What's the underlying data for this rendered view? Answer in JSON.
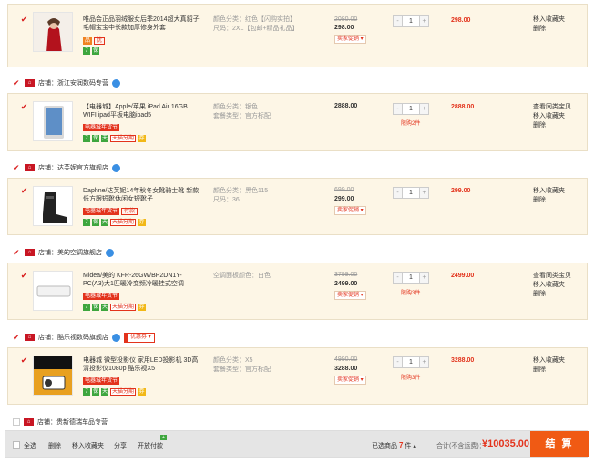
{
  "items": [
    {
      "title": "唯品会正品羽绒服女后季2014超大真貂子毛帽宝宝中长款加厚修身外套",
      "tags": [],
      "icons": [
        "7",
        "保"
      ],
      "attr1": "颜色分类：红色【闪购实拍】",
      "attr2": "尺码：2XL【包邮+精品礼品】",
      "old_price": "2080.00",
      "price": "298.00",
      "promo": "卖家促销 ▾",
      "qty": "1",
      "limit": "",
      "total": "298.00",
      "ops": [
        "移入收藏夹",
        "删除"
      ]
    },
    {
      "title": "【电器城】Apple/苹果 iPad Air 16GB WIFI ipad平板电脑ipad5",
      "tags": [
        "电器城年货节"
      ],
      "icons": [
        "7",
        "保",
        "天",
        "天猫分期",
        "券"
      ],
      "attr1": "颜色分类：银色",
      "attr2": "套餐类型：官方标配",
      "old_price": "",
      "price": "2888.00",
      "promo": "",
      "qty": "1",
      "limit": "限购2件",
      "total": "2888.00",
      "ops": [
        "查看同类宝贝",
        "移入收藏夹",
        "删除"
      ]
    },
    {
      "title": "Daphne/达芙妮14年秋冬女靴骑士靴 新款低方跟短靴休闲女短靴子",
      "tags": [
        "电器城年货节",
        "付款"
      ],
      "icons": [
        "7",
        "保",
        "天",
        "天猫分期",
        "券"
      ],
      "attr1": "颜色分类：黑色115",
      "attr2": "尺码：36",
      "old_price": "699.00",
      "price": "299.00",
      "promo": "卖家促销 ▾",
      "qty": "1",
      "limit": "",
      "total": "299.00",
      "ops": [
        "移入收藏夹",
        "删除"
      ]
    },
    {
      "title": "Midea/美的 KFR-26GW/BP2DN1Y-PC(A3)大1匹暖冷变频冷暖挂式空调",
      "tags": [
        "电器城年货节"
      ],
      "icons": [
        "7",
        "保",
        "天",
        "天猫分期",
        "券"
      ],
      "attr1": "空调面板颜色：白色",
      "attr2": "",
      "old_price": "3799.00",
      "price": "2499.00",
      "promo": "卖家促销 ▾",
      "qty": "1",
      "limit": "限购3件",
      "total": "2499.00",
      "ops": [
        "查看同类宝贝",
        "移入收藏夹",
        "删除"
      ]
    },
    {
      "title": "电器城 微型投影仪 家用LED投影机 3D高清投影仪1080p 酷乐视X5",
      "tags": [
        "电器城年货节"
      ],
      "icons": [
        "7",
        "保",
        "天",
        "天猫分期",
        "券"
      ],
      "attr1": "颜色分类：X5",
      "attr2": "套餐类型：官方标配",
      "old_price": "4990.00",
      "price": "3288.00",
      "promo": "卖家促销 ▾",
      "qty": "1",
      "limit": "限购3件",
      "total": "3288.00",
      "ops": [
        "移入收藏夹",
        "删除"
      ]
    }
  ],
  "shops": [
    {
      "label": "店铺：",
      "name": "浙江安润数码专营",
      "checked": true,
      "coupon": ""
    },
    {
      "label": "店铺：",
      "name": "达芙妮官方旗舰店",
      "checked": true,
      "coupon": ""
    },
    {
      "label": "店铺：",
      "name": "美的空调旗舰店",
      "checked": true,
      "coupon": ""
    },
    {
      "label": "店铺：",
      "name": "酷乐视数码旗舰店",
      "checked": true,
      "coupon": "优惠券 ▾"
    },
    {
      "label": "店铺：",
      "name": "贵新德瑞车品专营",
      "checked": false,
      "coupon": ""
    }
  ],
  "footer": {
    "select_all": "全选",
    "delete": "删除",
    "move_fav": "移入收藏夹",
    "share": "分享",
    "open_paid": "开放付款",
    "selected_prefix": "已选商品",
    "selected_count": "7",
    "selected_suffix": "件",
    "summary": "合计(不含运费)：",
    "amount": "¥10035.00",
    "checkout": "结 算"
  },
  "colors": {
    "accent": "#e3331c",
    "row_bg": "#fdf6e6",
    "checkout_bg": "#f05a14"
  }
}
